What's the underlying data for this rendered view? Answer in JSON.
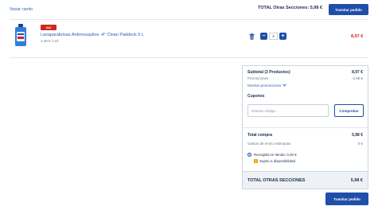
{
  "header": {
    "empty_cart_link": "Vaciar carrito",
    "total_label": "TOTAL Otras Secciones:",
    "total_value": "5,98 €",
    "checkout_button": "Tramitar pedido"
  },
  "product": {
    "badge": "3x2",
    "name": "Lavaparabrisas Antimosquitos -4° Clean Paddock 5 L",
    "unit_price": "2,49 € / Ud",
    "quantity": "3",
    "price": "8,97 €",
    "price_color": "#d1251f"
  },
  "summary": {
    "subtotal_label": "Subtotal (3 Productos)",
    "subtotal_value": "8,97 €",
    "promotions_label": "Promociones",
    "promotions_value": "-2,99 €",
    "show_promotions": "Mostrar promociones",
    "coupons_title": "Cupones",
    "coupon_placeholder": "Insertar código...",
    "coupon_button": "Comprobar",
    "total_purchase_label": "Total compra",
    "total_purchase_value": "5,98 €",
    "shipping_label": "Gastos de envío estimados",
    "shipping_value": "0 €",
    "pickup_label": "Recogida en tienda: 0,00 €",
    "availability_label": "Sujeto a disponibilidad",
    "total_sections_label": "TOTAL OTRAS SECCIONES",
    "total_sections_value": "5,98 €"
  },
  "footer": {
    "checkout_button": "Tramitar pedido"
  },
  "icons": {
    "trash": "trash-icon",
    "chevron": "chevron-down-icon",
    "warning": "warning-icon"
  },
  "colors": {
    "primary": "#1f4fa8",
    "accent_red": "#d1251f",
    "warning": "#f0a500"
  }
}
